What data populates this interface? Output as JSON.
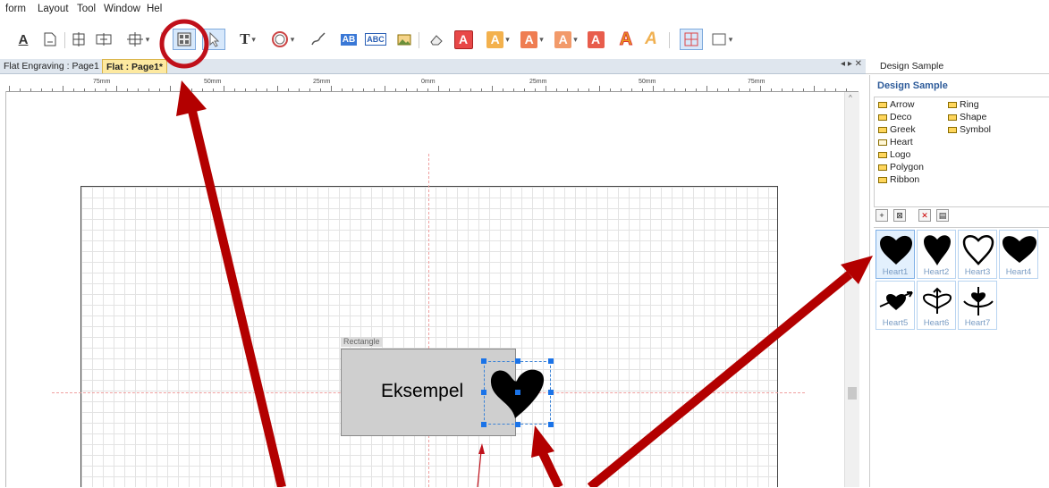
{
  "menu": {
    "items": [
      "form",
      "Layout",
      "Tool",
      "Window",
      "Hel"
    ]
  },
  "toolbar": {
    "text_tool": "T",
    "text_style_1": "AB",
    "text_style_2": "ABC",
    "letter_a": "A"
  },
  "tabs": [
    {
      "label": "Flat Engraving : Page1"
    },
    {
      "label": "Flat : Page1*"
    }
  ],
  "tab_controls": "◂ ▸ ✕",
  "ruler": {
    "labels": [
      "75mm",
      "50mm",
      "25mm",
      "0mm",
      "25mm",
      "50mm",
      "75mm"
    ]
  },
  "canvas": {
    "object_label": "Rectangle",
    "rect_text": "Eksempel",
    "colors": {
      "rect_fill": "#cfcfcf",
      "selection": "#1a73e8",
      "guide": "#f0a0a0"
    }
  },
  "panel": {
    "header": "Design Sample",
    "title": "Design Sample",
    "folders_col1": [
      "Arrow",
      "Deco",
      "Greek",
      "Heart",
      "Logo",
      "Polygon",
      "Ribbon"
    ],
    "folders_col2": [
      "Ring",
      "Shape",
      "Symbol"
    ],
    "thumbnails": [
      {
        "label": "Heart1",
        "icon": "solid-heart-icon"
      },
      {
        "label": "Heart2",
        "icon": "solid-heart-icon"
      },
      {
        "label": "Heart3",
        "icon": "outline-heart-icon"
      },
      {
        "label": "Heart4",
        "icon": "solid-heart-icon"
      },
      {
        "label": "Heart5",
        "icon": "heart-arrow-icon"
      },
      {
        "label": "Heart6",
        "icon": "heart-bow-icon"
      },
      {
        "label": "Heart7",
        "icon": "heart-bow-arrow-icon"
      }
    ]
  },
  "annotation_colors": {
    "arrow": "#b30000",
    "circle": "#c0101a"
  }
}
